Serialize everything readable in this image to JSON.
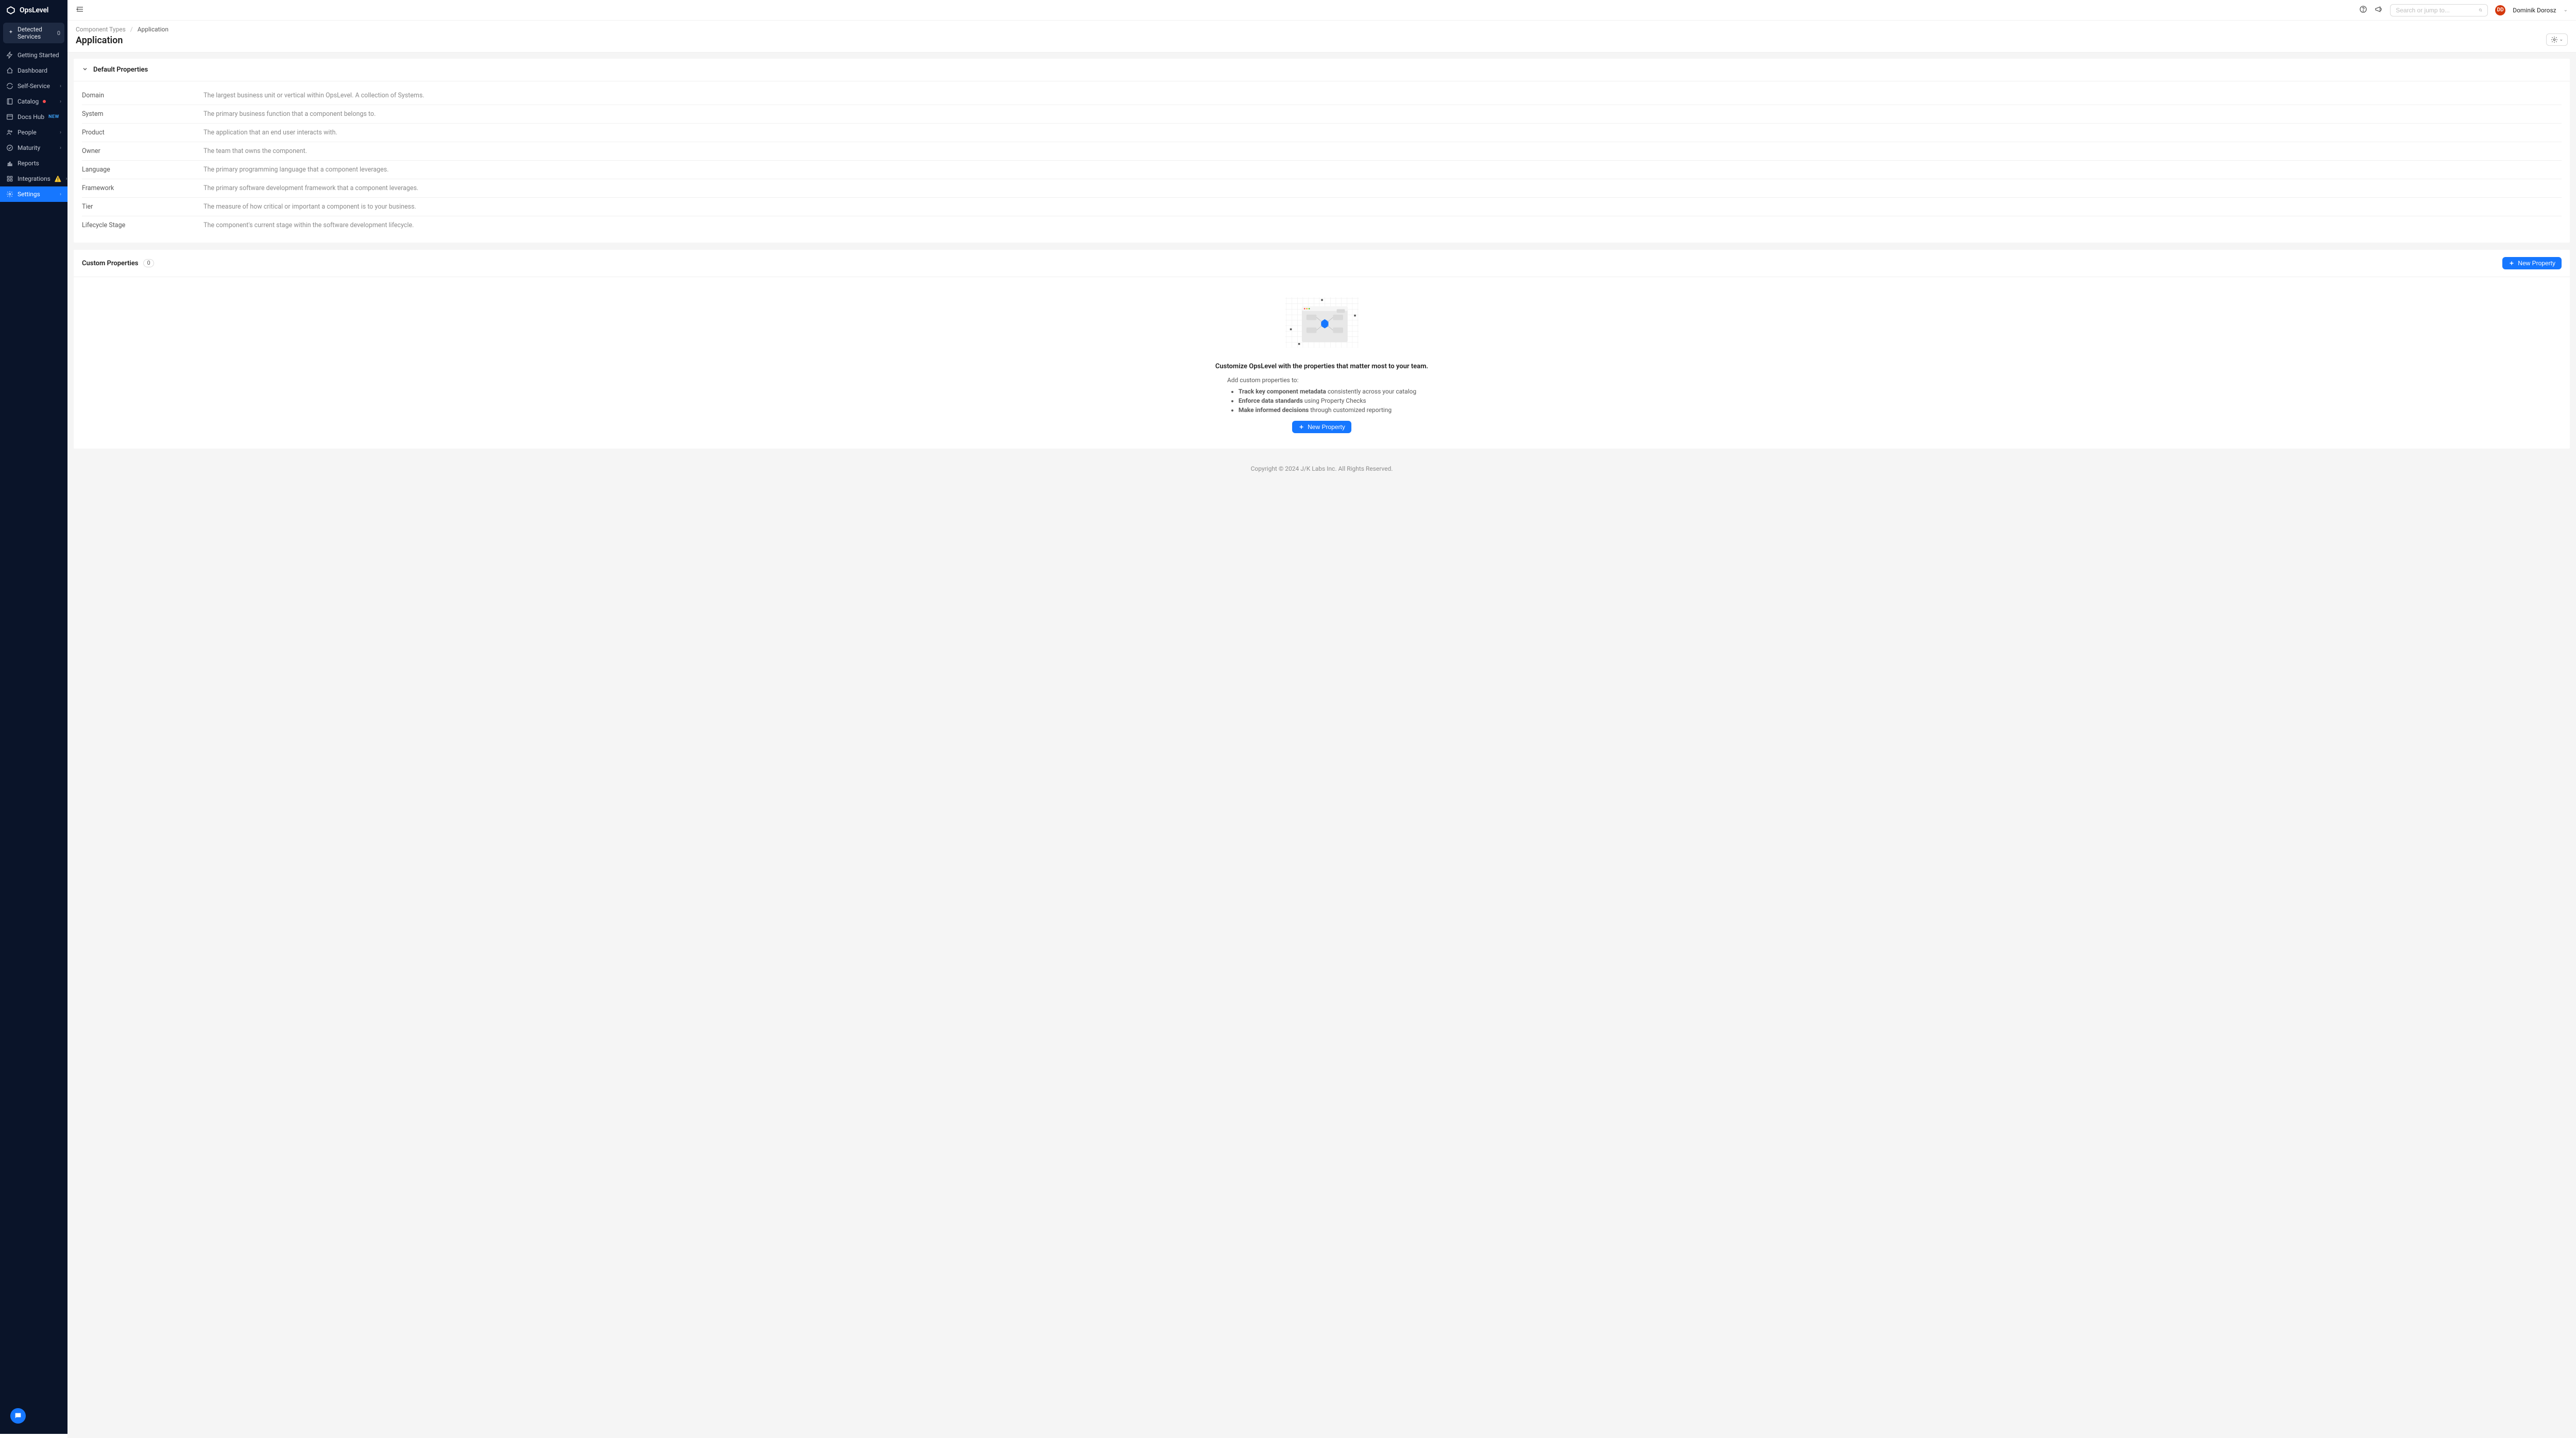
{
  "brand": {
    "name": "OpsLevel"
  },
  "sidebar": {
    "detected_services": {
      "label": "Detected Services",
      "count": "0"
    },
    "items": [
      {
        "label": "Getting Started",
        "expandable": false
      },
      {
        "label": "Dashboard",
        "expandable": false
      },
      {
        "label": "Self-Service",
        "expandable": true
      },
      {
        "label": "Catalog",
        "expandable": true,
        "dot": true
      },
      {
        "label": "Docs Hub",
        "expandable": false,
        "new_badge": "NEW"
      },
      {
        "label": "People",
        "expandable": true
      },
      {
        "label": "Maturity",
        "expandable": true
      },
      {
        "label": "Reports",
        "expandable": false
      },
      {
        "label": "Integrations",
        "expandable": true,
        "warn": true
      },
      {
        "label": "Settings",
        "expandable": true,
        "active": true
      }
    ]
  },
  "topbar": {
    "search_placeholder": "Search or jump to...",
    "user": {
      "initials": "DD",
      "name": "Dominik Dorosz"
    }
  },
  "breadcrumb": {
    "parent": "Component Types",
    "current": "Application"
  },
  "page": {
    "title": "Application"
  },
  "default_properties": {
    "title": "Default Properties",
    "rows": [
      {
        "name": "Domain",
        "desc": "The largest business unit or vertical within OpsLevel. A collection of Systems."
      },
      {
        "name": "System",
        "desc": "The primary business function that a component belongs to."
      },
      {
        "name": "Product",
        "desc": "The application that an end user interacts with."
      },
      {
        "name": "Owner",
        "desc": "The team that owns the component."
      },
      {
        "name": "Language",
        "desc": "The primary programming language that a component leverages."
      },
      {
        "name": "Framework",
        "desc": "The primary software development framework that a component leverages."
      },
      {
        "name": "Tier",
        "desc": "The measure of how critical or important a component is to your business."
      },
      {
        "name": "Lifecycle Stage",
        "desc": "The component's current stage within the software development lifecycle."
      }
    ]
  },
  "custom_properties": {
    "title": "Custom Properties",
    "count": "0",
    "new_button": "New Property",
    "empty": {
      "headline": "Customize OpsLevel with the properties that matter most to your team.",
      "subhead": "Add custom properties to:",
      "bullets": [
        {
          "bold": "Track key component metadata",
          "rest": " consistently across your catalog"
        },
        {
          "bold": "Enforce data standards",
          "rest": " using Property Checks"
        },
        {
          "bold": "Make informed decisions",
          "rest": " through customized reporting"
        }
      ],
      "cta": "New Property"
    }
  },
  "footer": {
    "text": "Copyright © 2024 J/K Labs Inc. All Rights Reserved."
  }
}
